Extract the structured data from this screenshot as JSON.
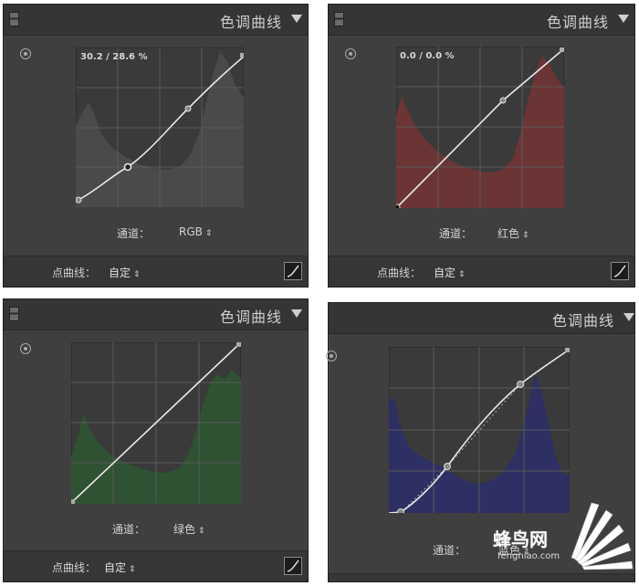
{
  "panels": [
    {
      "title": "色调曲线",
      "readout": "30.2 / 28.6 %",
      "channel_label": "通道：",
      "channel_value": "RGB",
      "point_curve_label": "点曲线：",
      "point_curve_value": "自定",
      "histogram_color": "#4a4a4a"
    },
    {
      "title": "色调曲线",
      "readout": "0.0 / 0.0 %",
      "channel_label": "通道：",
      "channel_value": "红色",
      "point_curve_label": "点曲线：",
      "point_curve_value": "自定",
      "histogram_color": "#6b3435"
    },
    {
      "title": "色调曲线",
      "readout": "",
      "channel_label": "通道：",
      "channel_value": "绿色",
      "point_curve_label": "点曲线：",
      "point_curve_value": "自定",
      "histogram_color": "#2f5232"
    },
    {
      "title": "色调曲线",
      "readout": "",
      "channel_label": "通道：",
      "channel_value": "蓝色",
      "point_curve_label": "",
      "point_curve_value": "",
      "histogram_color": "#2e2f63"
    }
  ],
  "watermark": {
    "text": "蜂鸟网",
    "subtext": "fengniao.com"
  }
}
